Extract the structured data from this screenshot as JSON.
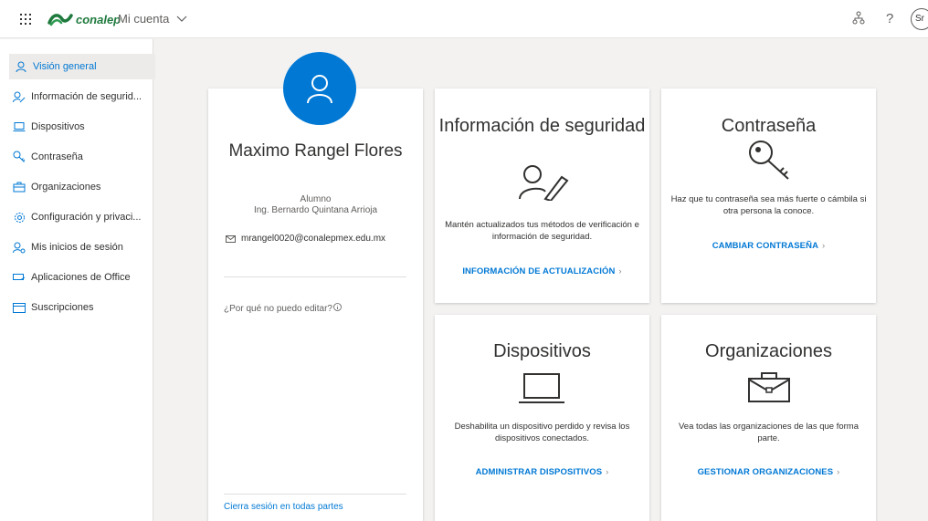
{
  "topbar": {
    "logo_text": "conalep",
    "account_label": "Mi cuenta",
    "help_label": "?",
    "avatar_initials": "Sr"
  },
  "sidebar": {
    "items": [
      {
        "label": "Visión general",
        "icon": "person-icon",
        "active": true
      },
      {
        "label": "Información de segurid...",
        "icon": "person-key-icon"
      },
      {
        "label": "Dispositivos",
        "icon": "laptop-icon"
      },
      {
        "label": "Contraseña",
        "icon": "key-icon"
      },
      {
        "label": "Organizaciones",
        "icon": "briefcase-icon"
      },
      {
        "label": "Configuración y privaci...",
        "icon": "settings-gear-icon"
      },
      {
        "label": "Mis inicios de sesión",
        "icon": "person-key-icon"
      },
      {
        "label": "Aplicaciones de Office",
        "icon": "office-apps-icon"
      },
      {
        "label": "Suscripciones",
        "icon": "subscription-card-icon"
      }
    ]
  },
  "profile": {
    "name": "Maximo Rangel Flores",
    "role": "Alumno",
    "school": "Ing. Bernardo Quintana Arrioja",
    "email": "mrangel0020@conalepmex.edu.mx",
    "why_cant_edit": "¿Por qué no puedo editar?",
    "sign_out_everywhere": "Cierra sesión en todas partes"
  },
  "cards": {
    "security": {
      "title": "Información de seguridad",
      "description": "Mantén actualizados tus métodos de verificación e información de seguridad.",
      "link": "INFORMACIÓN DE ACTUALIZACIÓN"
    },
    "password": {
      "title": "Contraseña",
      "description": "Haz que tu contraseña sea más fuerte o cámbila si otra persona la conoce.",
      "link": "CAMBIAR CONTRASEÑA"
    },
    "devices": {
      "title": "Dispositivos",
      "description": "Deshabilita un dispositivo perdido y revisa los dispositivos conectados.",
      "link": "ADMINISTRAR DISPOSITIVOS"
    },
    "organizations": {
      "title": "Organizaciones",
      "description": "Vea todas las organizaciones de las que forma parte.",
      "link": "GESTIONAR ORGANIZACIONES"
    }
  },
  "colors": {
    "accent": "#0078d4",
    "brand_green": "#1f7a3e",
    "background": "#f3f2f1"
  }
}
